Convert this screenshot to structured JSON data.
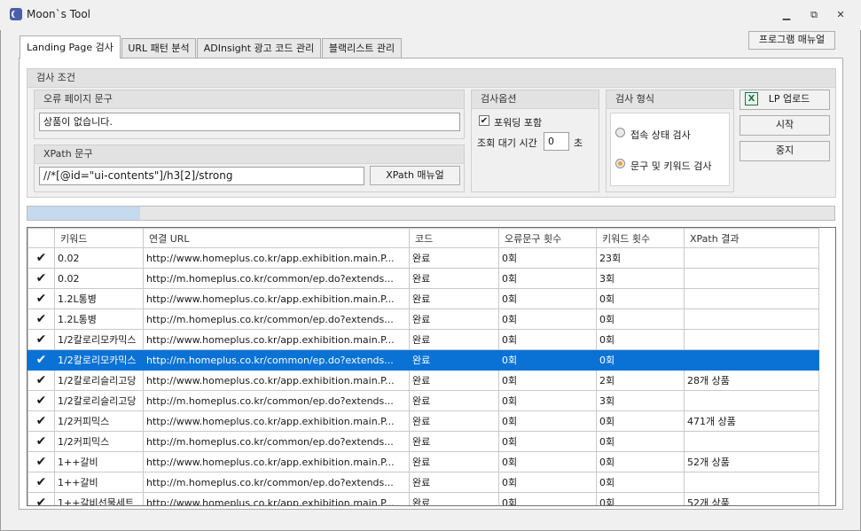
{
  "window": {
    "title": "Moon`s Tool"
  },
  "tabs": [
    "Landing Page 검사",
    "URL 패턴 분석",
    "ADInsight 광고 코드 관리",
    "블랙리스트 관리"
  ],
  "manual_button": "프로그램 매뉴얼",
  "conditions": {
    "title": "검사 조건",
    "error_text_label": "오류 페이지 문구",
    "error_text_value": "상품이 없습니다.",
    "xpath_label": "XPath 문구",
    "xpath_value": "//*[@id=\"ui-contents\"]/h3[2]/strong",
    "xpath_manual_button": "XPath 매뉴얼"
  },
  "options": {
    "title": "검사옵션",
    "forwarding_label": "포워딩 포함",
    "forwarding_checked": true,
    "wait_label": "조회 대기 시간",
    "wait_value": "0",
    "wait_unit": "초"
  },
  "format": {
    "title": "검사 형식",
    "radio1": "접속 상태 검사",
    "radio2": "문구 및 키워드 검사",
    "selected": 2
  },
  "actions": {
    "upload": "LP 업로드",
    "start": "시작",
    "stop": "중지"
  },
  "progress": {
    "fraction": 0.14
  },
  "table": {
    "columns": [
      "",
      "키워드",
      "연결 URL",
      "코드",
      "오류문구 횟수",
      "키워드 횟수",
      "XPath 결과"
    ],
    "rows": [
      [
        "✔",
        "0.02",
        "http://www.homeplus.co.kr/app.exhibition.main.P...",
        "완료",
        "0회",
        "23회",
        ""
      ],
      [
        "✔",
        "0.02",
        "http://m.homeplus.co.kr/common/ep.do?extends...",
        "완료",
        "0회",
        "3회",
        ""
      ],
      [
        "✔",
        "1.2L통병",
        "http://www.homeplus.co.kr/app.exhibition.main.P...",
        "완료",
        "0회",
        "0회",
        ""
      ],
      [
        "✔",
        "1.2L통병",
        "http://m.homeplus.co.kr/common/ep.do?extends...",
        "완료",
        "0회",
        "0회",
        ""
      ],
      [
        "✔",
        "1/2칼로리모카믹스",
        "http://www.homeplus.co.kr/app.exhibition.main.P...",
        "완료",
        "0회",
        "0회",
        ""
      ],
      [
        "✔",
        "1/2칼로리모카믹스",
        "http://m.homeplus.co.kr/common/ep.do?extends...",
        "완료",
        "0회",
        "0회",
        ""
      ],
      [
        "✔",
        "1/2칼로리슬리고당",
        "http://www.homeplus.co.kr/app.exhibition.main.P...",
        "완료",
        "0회",
        "2회",
        "28개 상품"
      ],
      [
        "✔",
        "1/2칼로리슬리고당",
        "http://m.homeplus.co.kr/common/ep.do?extends...",
        "완료",
        "0회",
        "3회",
        ""
      ],
      [
        "✔",
        "1/2커피믹스",
        "http://www.homeplus.co.kr/app.exhibition.main.P...",
        "완료",
        "0회",
        "0회",
        "471개 상품"
      ],
      [
        "✔",
        "1/2커피믹스",
        "http://m.homeplus.co.kr/common/ep.do?extends...",
        "완료",
        "0회",
        "0회",
        ""
      ],
      [
        "✔",
        "1++갈비",
        "http://www.homeplus.co.kr/app.exhibition.main.P...",
        "완료",
        "0회",
        "0회",
        "52개 상품"
      ],
      [
        "✔",
        "1++갈비",
        "http://m.homeplus.co.kr/common/ep.do?extends...",
        "완료",
        "0회",
        "0회",
        ""
      ],
      [
        "✔",
        "1++갈비선물세트",
        "http://www.homeplus.co.kr/app.exhibition.main.P...",
        "완료",
        "0회",
        "0회",
        "52개 상품"
      ]
    ],
    "selected_row": 5
  },
  "colors": {
    "selection": "#0a72d4",
    "radio_on": "#f0a030"
  }
}
